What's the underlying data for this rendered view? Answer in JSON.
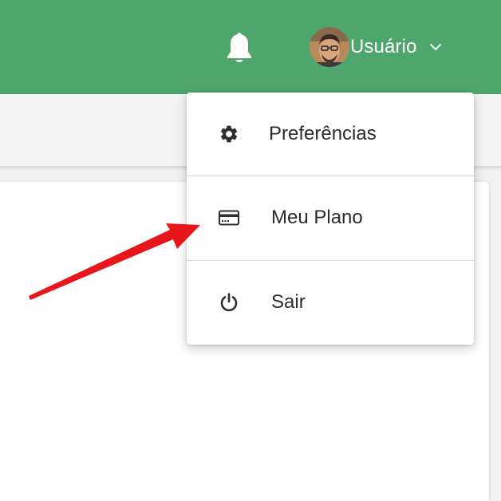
{
  "header": {
    "notifications_icon": "bell-icon",
    "user_name": "Usuário",
    "avatar_icon": "user-avatar",
    "dropdown_icon": "chevron-down-icon"
  },
  "menu": {
    "items": [
      {
        "label": "Preferências",
        "icon": "gear-icon"
      },
      {
        "label": "Meu Plano",
        "icon": "credit-card-icon"
      },
      {
        "label": "Sair",
        "icon": "power-icon"
      }
    ]
  },
  "colors": {
    "header_bg": "#4fa66d",
    "annotation_arrow": "#e8161b",
    "text": "#2b2b2b"
  }
}
